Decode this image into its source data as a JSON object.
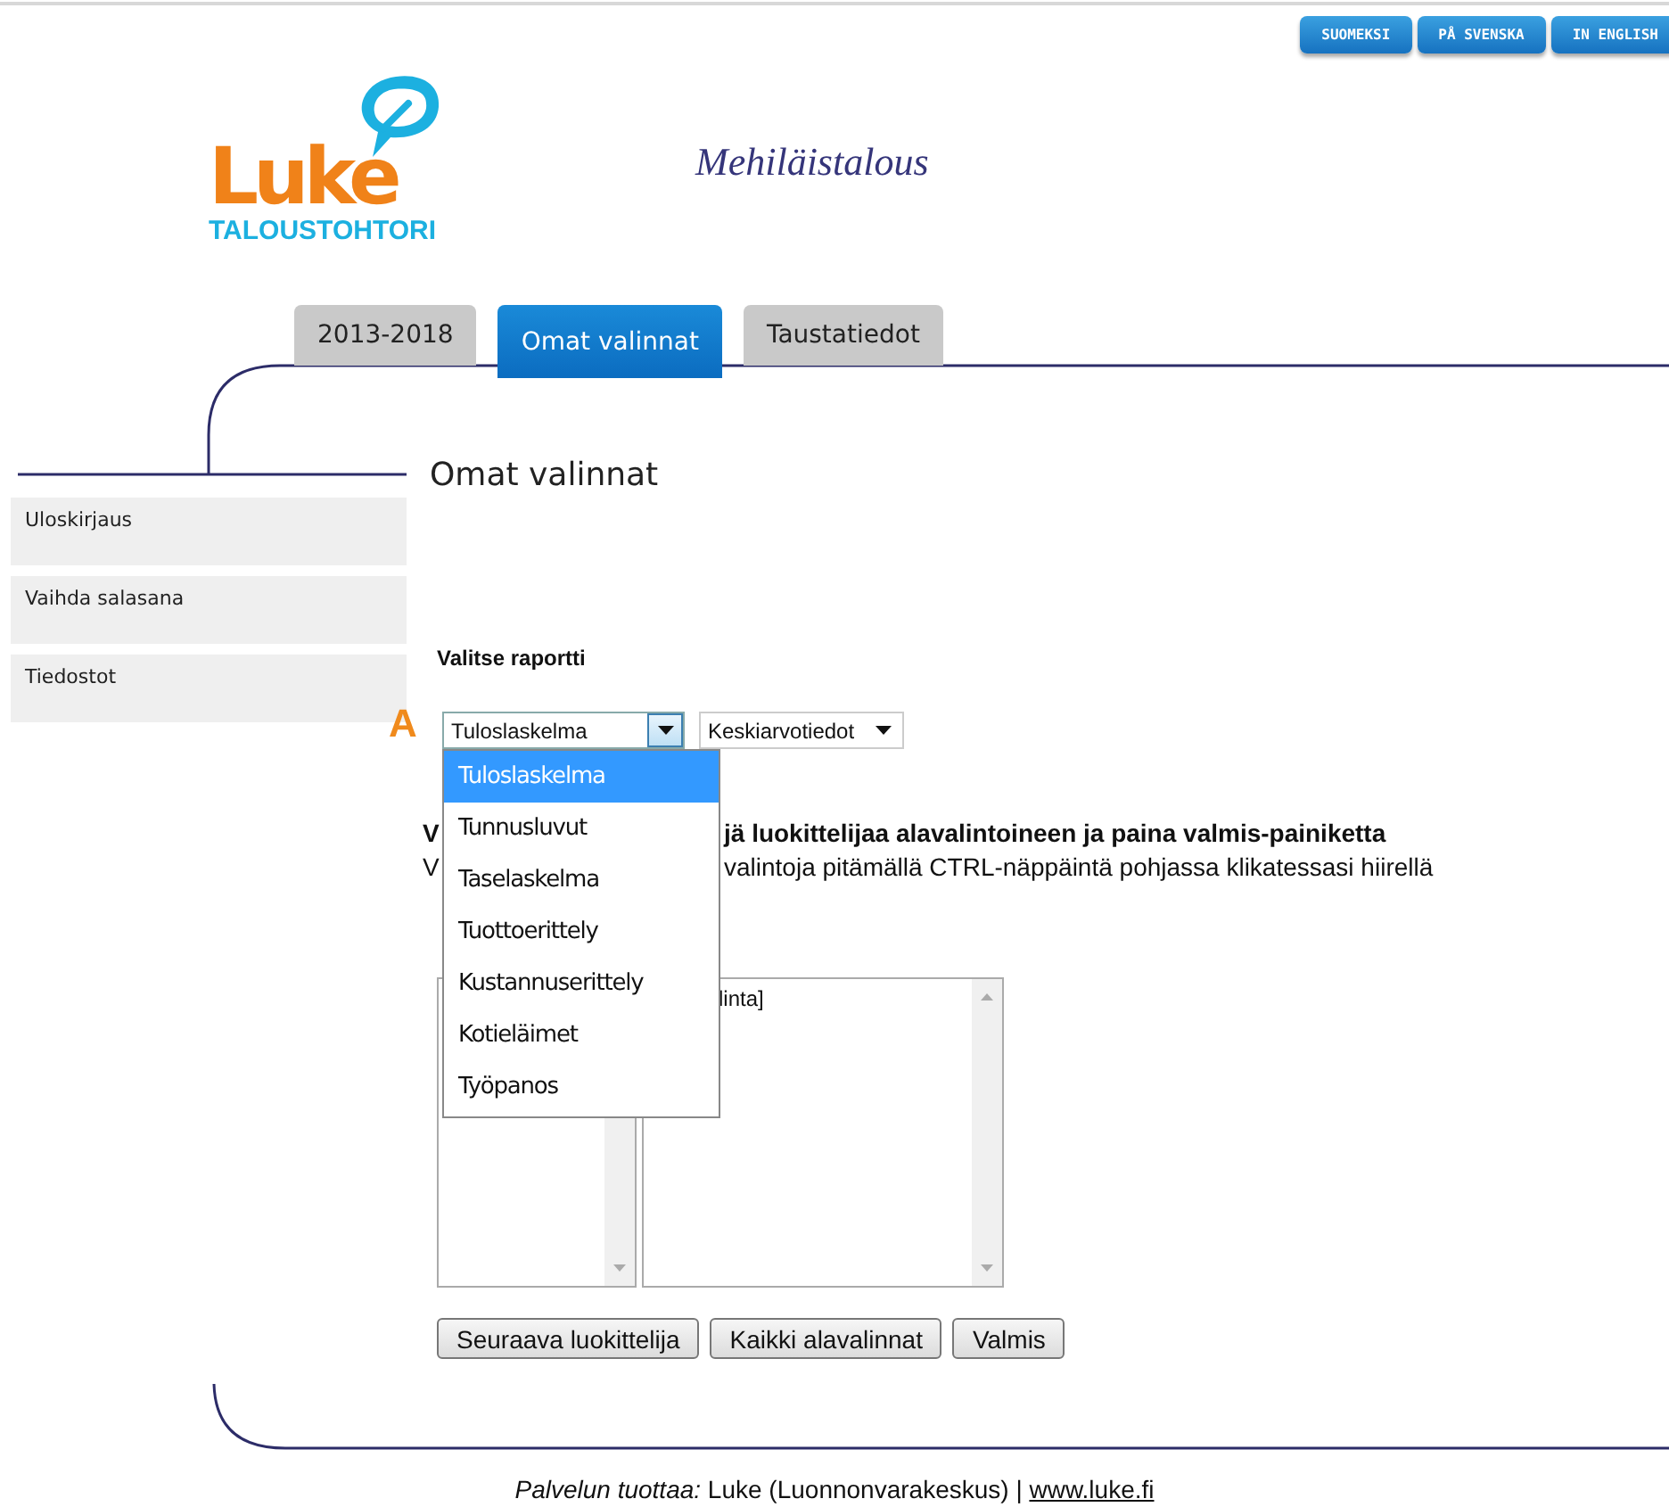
{
  "language_buttons": [
    {
      "label": "SUOMEKSI"
    },
    {
      "label": "PÅ SVENSKA"
    },
    {
      "label": "IN ENGLISH"
    }
  ],
  "logo": {
    "word": "Luke",
    "subtitle": "TALOUSTOHTORI"
  },
  "site_title": "Mehiläistalous",
  "tabs": [
    {
      "label": "2013-2018",
      "selected": false
    },
    {
      "label": "Omat valinnat",
      "selected": true
    },
    {
      "label": "Taustatiedot",
      "selected": false
    }
  ],
  "sidebar": {
    "items": [
      {
        "label": "Uloskirjaus"
      },
      {
        "label": "Vaihda salasana"
      },
      {
        "label": "Tiedostot"
      }
    ]
  },
  "page_heading": "Omat valinnat",
  "report_label": "Valitse raportti",
  "marker": "A",
  "report_select": {
    "value": "Tuloslaskelma",
    "open": true,
    "options": [
      {
        "label": "Tuloslaskelma",
        "selected": true
      },
      {
        "label": "Tunnusluvut",
        "selected": false
      },
      {
        "label": "Taselaskelma",
        "selected": false
      },
      {
        "label": "Tuottoerittely",
        "selected": false
      },
      {
        "label": "Kustannuserittely",
        "selected": false
      },
      {
        "label": "Kotieläimet",
        "selected": false
      },
      {
        "label": "Työpanos",
        "selected": false
      }
    ]
  },
  "data_select": {
    "value": "Keskiarvotiedot"
  },
  "instructions": [
    {
      "start": "V",
      "rest": "jä luokittelijaa alavalintoineen ja paina valmis-painiketta",
      "bold": true
    },
    {
      "start": "V",
      "rest": "valintoja pitämällä CTRL-näppäintä pohjassa klikatessasi hiirellä",
      "bold": false
    }
  ],
  "listboxes": [
    {
      "kind": "listbox"
    },
    {
      "kind": "listbox",
      "items": [
        "linta]"
      ]
    }
  ],
  "buttons": [
    "Seuraava luokittelija",
    "Kaikki alavalinnat",
    "Valmis"
  ],
  "footer": {
    "text": "*Palvelun tuottaa:* Luke (Luonnonvarakeskus) | ",
    "link": "www.luke.fi"
  }
}
